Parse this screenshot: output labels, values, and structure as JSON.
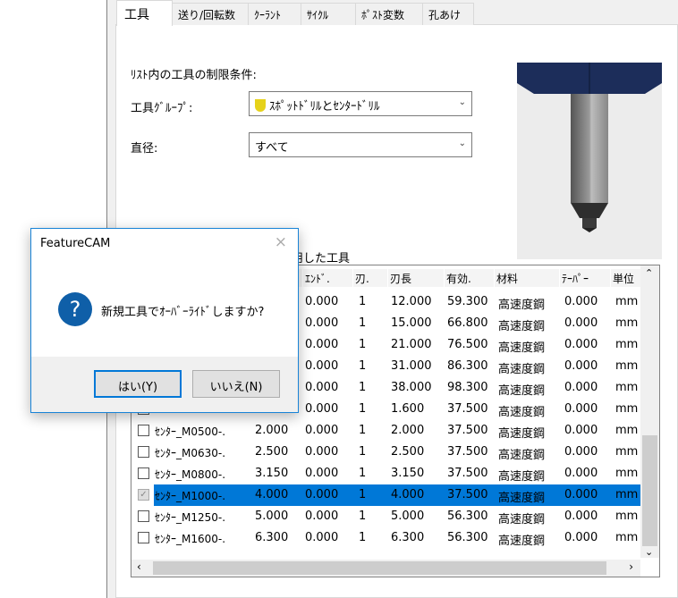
{
  "tabs": [
    "工具",
    "送り/回転数",
    "ｸｰﾗﾝﾄ",
    "ｻｲｸﾙ",
    "ﾎﾟｽﾄ変数",
    "孔あけ"
  ],
  "filter": {
    "heading": "ﾘｽﾄ内の工具の制限条件:",
    "group_label": "工具ｸﾞﾙｰﾌﾟ:",
    "group_value": "ｽﾎﾟｯﾄﾄﾞﾘﾙとｾﾝﾀｰﾄﾞﾘﾙ",
    "diameter_label": "直径:",
    "diameter_value": "すべて"
  },
  "recent_label": "近使用した工具",
  "columns": [
    "",
    "",
    "ｴﾝﾄﾞ.",
    "刃.",
    "刃長",
    "有効.",
    "材料",
    "ﾃｰﾊﾟｰ",
    "単位"
  ],
  "rows": [
    {
      "checked": false,
      "name": "",
      "dia": "",
      "end": "0.000",
      "flutes": "1",
      "len": "12.000",
      "eff": "59.300",
      "mat": "高速度鋼",
      "taper": "0.000",
      "unit": "mm"
    },
    {
      "checked": false,
      "name": "",
      "dia": "",
      "end": "0.000",
      "flutes": "1",
      "len": "15.000",
      "eff": "66.800",
      "mat": "高速度鋼",
      "taper": "0.000",
      "unit": "mm"
    },
    {
      "checked": false,
      "name": "",
      "dia": "",
      "end": "0.000",
      "flutes": "1",
      "len": "21.000",
      "eff": "76.500",
      "mat": "高速度鋼",
      "taper": "0.000",
      "unit": "mm"
    },
    {
      "checked": false,
      "name": "",
      "dia": "",
      "end": "0.000",
      "flutes": "1",
      "len": "31.000",
      "eff": "86.300",
      "mat": "高速度鋼",
      "taper": "0.000",
      "unit": "mm"
    },
    {
      "checked": false,
      "name": "",
      "dia": "",
      "end": "0.000",
      "flutes": "1",
      "len": "38.000",
      "eff": "98.300",
      "mat": "高速度鋼",
      "taper": "0.000",
      "unit": "mm"
    },
    {
      "checked": false,
      "name": "",
      "dia": "",
      "end": "0.000",
      "flutes": "1",
      "len": "1.600",
      "eff": "37.500",
      "mat": "高速度鋼",
      "taper": "0.000",
      "unit": "mm"
    },
    {
      "checked": false,
      "name": "ｾﾝﾀｰ_M0500-.",
      "dia": "2.000",
      "end": "0.000",
      "flutes": "1",
      "len": "2.000",
      "eff": "37.500",
      "mat": "高速度鋼",
      "taper": "0.000",
      "unit": "mm"
    },
    {
      "checked": false,
      "name": "ｾﾝﾀｰ_M0630-.",
      "dia": "2.500",
      "end": "0.000",
      "flutes": "1",
      "len": "2.500",
      "eff": "37.500",
      "mat": "高速度鋼",
      "taper": "0.000",
      "unit": "mm"
    },
    {
      "checked": false,
      "name": "ｾﾝﾀｰ_M0800-.",
      "dia": "3.150",
      "end": "0.000",
      "flutes": "1",
      "len": "3.150",
      "eff": "37.500",
      "mat": "高速度鋼",
      "taper": "0.000",
      "unit": "mm"
    },
    {
      "checked": true,
      "selected": true,
      "name": "ｾﾝﾀｰ_M1000-.",
      "dia": "4.000",
      "end": "0.000",
      "flutes": "1",
      "len": "4.000",
      "eff": "37.500",
      "mat": "高速度鋼",
      "taper": "0.000",
      "unit": "mm"
    },
    {
      "checked": false,
      "name": "ｾﾝﾀｰ_M1250-.",
      "dia": "5.000",
      "end": "0.000",
      "flutes": "1",
      "len": "5.000",
      "eff": "56.300",
      "mat": "高速度鋼",
      "taper": "0.000",
      "unit": "mm"
    },
    {
      "checked": false,
      "name": "ｾﾝﾀｰ_M1600-.",
      "dia": "6.300",
      "end": "0.000",
      "flutes": "1",
      "len": "6.300",
      "eff": "56.300",
      "mat": "高速度鋼",
      "taper": "0.000",
      "unit": "mm"
    }
  ],
  "dialog": {
    "title": "FeatureCAM",
    "message": "新規工具でｵｰﾊﾞｰﾗｲﾄﾞしますか?",
    "yes": "はい(Y)",
    "no": "いいえ(N)",
    "icon": "question-icon"
  },
  "colors": {
    "accent": "#0078d7",
    "holder": "#1c2d5a",
    "icon": "#0f5fa8"
  }
}
